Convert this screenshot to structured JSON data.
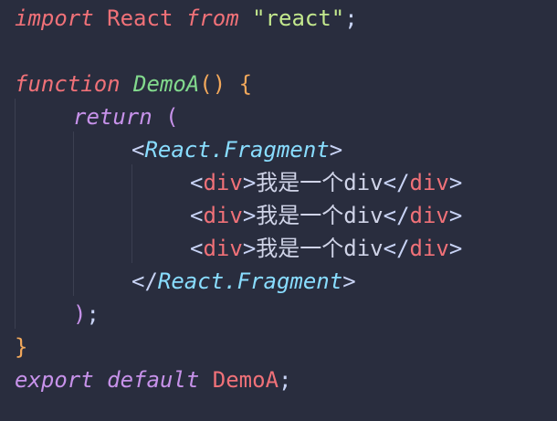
{
  "code": {
    "l1": {
      "import": "import",
      "react": "React",
      "from": "from",
      "module": "\"react\"",
      "semi": ";"
    },
    "l3": {
      "function": "function",
      "name": "DemoA",
      "parens": "()",
      "brace": "{"
    },
    "l4": {
      "return": "return",
      "paren": "("
    },
    "l5": {
      "open": "<",
      "comp": "React.Fragment",
      "close": ">"
    },
    "div": {
      "lt": "<",
      "tag": "div",
      "gt": ">",
      "text": "我是一个div",
      "lt_close": "</",
      "tag_close": "div",
      "gt_close": ">"
    },
    "l9": {
      "open": "</",
      "comp": "React.Fragment",
      "close": ">"
    },
    "l10": {
      "paren": ")",
      "semi": ";"
    },
    "l11": {
      "brace": "}"
    },
    "l12": {
      "export": "export",
      "default": "default",
      "name": "DemoA",
      "semi": ";"
    }
  }
}
